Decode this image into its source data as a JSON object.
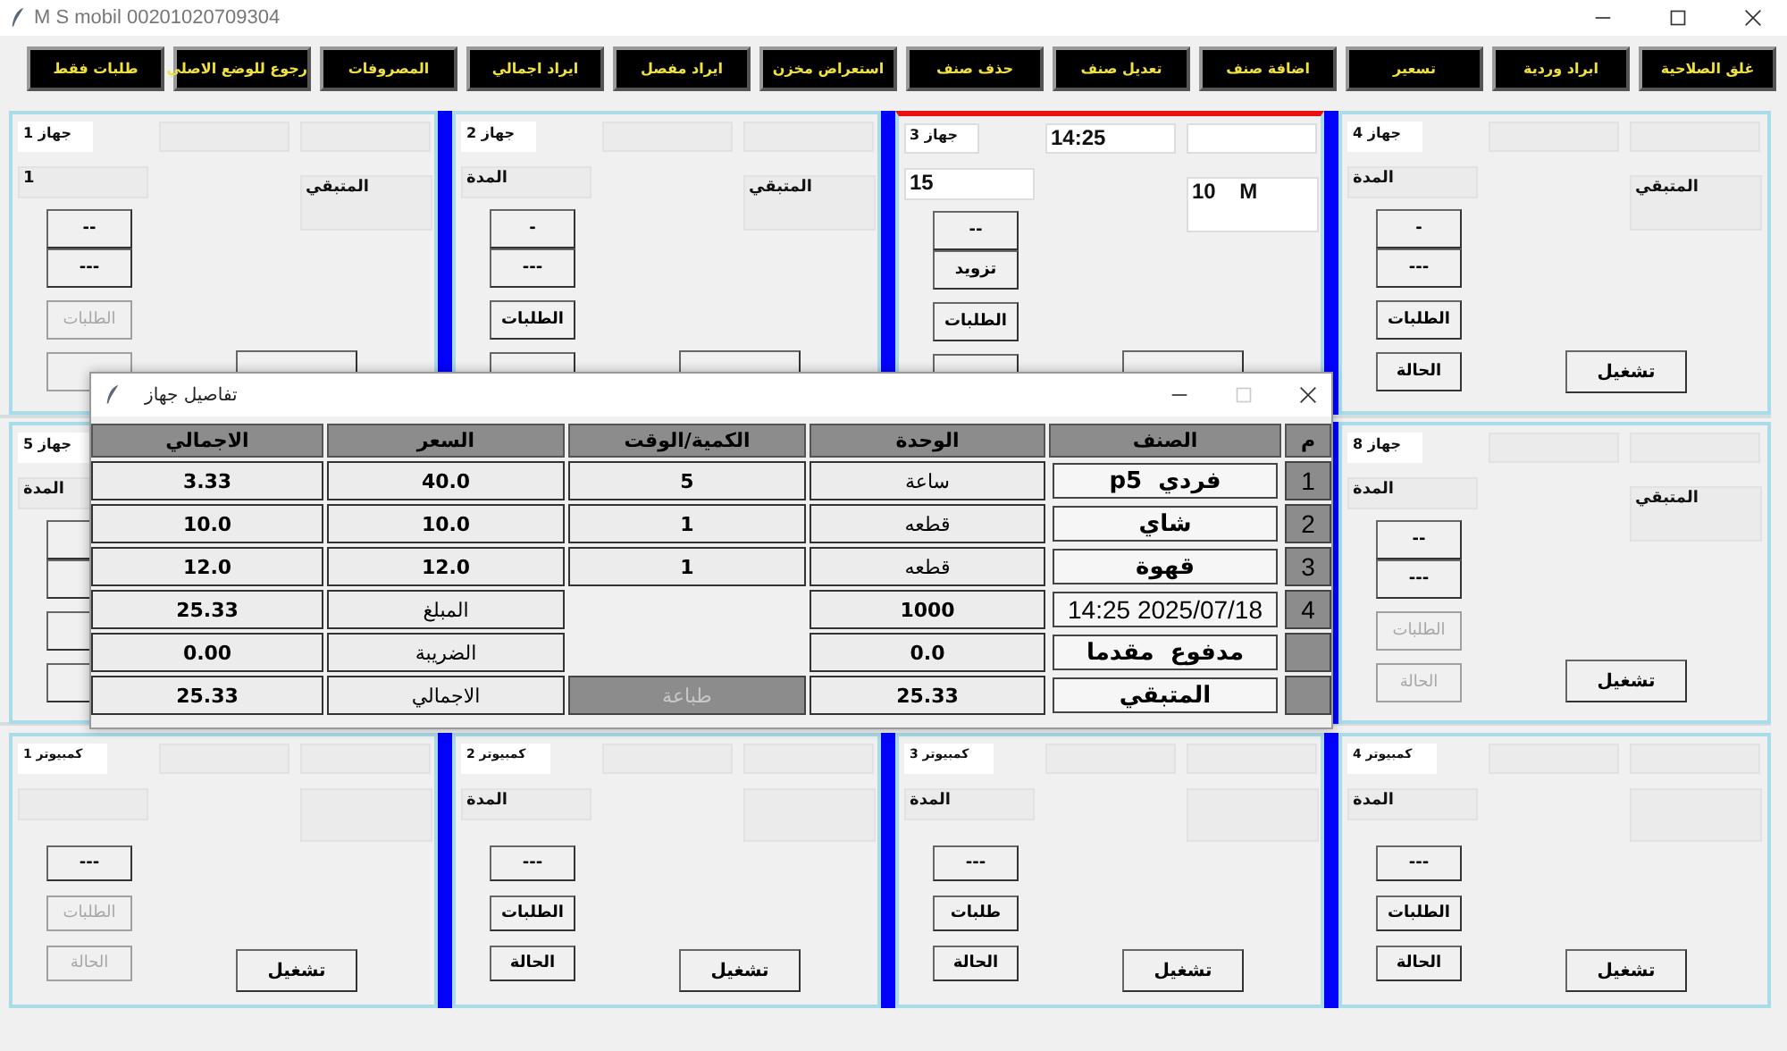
{
  "window": {
    "title": "M S mobil 00201020709304"
  },
  "toolbar": [
    "غلق الصلاحية",
    "ابراد وردية",
    "تسعير",
    "اضافة صنف",
    "تعديل صنف",
    "حذف صنف",
    "استعراض مخزن",
    "ايراد مفصل",
    "ايراد اجمالي",
    "المصروفات",
    "رجوع  للوضع الاصلي",
    "طلبات فقط"
  ],
  "device_rows": [
    [
      {
        "name": "جهاز 4",
        "running": false,
        "duration": "المدة",
        "remaining": "المتبقي",
        "buttons": [
          {
            "label": "-",
            "disabled": false
          },
          {
            "label": "---",
            "disabled": false
          },
          {
            "label": "الطلبات",
            "disabled": false
          },
          {
            "label": "الحالة",
            "disabled": false
          }
        ],
        "start": {
          "label": "تشغيل",
          "disabled": false
        }
      },
      {
        "name": "جهاز 3",
        "running": true,
        "time": "14:25",
        "duration": "15",
        "remaining": "10    M",
        "buttons": [
          {
            "label": "--",
            "disabled": false
          },
          {
            "label": "تزويد",
            "disabled": false
          },
          {
            "label": "الطلبات",
            "disabled": false
          },
          {
            "disabled": false
          }
        ],
        "start": {
          "disabled": false
        }
      },
      {
        "name": "جهاز 2",
        "running": false,
        "duration": "المدة",
        "remaining": "المتبقي",
        "buttons": [
          {
            "label": "-",
            "disabled": false
          },
          {
            "label": "---",
            "disabled": false
          },
          {
            "label": "الطلبات",
            "disabled": false
          },
          {
            "disabled": false
          }
        ],
        "start": {
          "disabled": false
        }
      },
      {
        "name": "جهاز 1",
        "running": false,
        "duration": "1",
        "remaining": "المتبقي",
        "buttons": [
          {
            "label": "--",
            "disabled": false
          },
          {
            "label": "---",
            "disabled": false
          },
          {
            "label": "الطلبات",
            "disabled": true
          },
          {
            "disabled": true
          }
        ],
        "start": {
          "disabled": false
        }
      }
    ],
    [
      {
        "name": "جهاز 8",
        "running": false,
        "duration": "المدة",
        "remaining": "المتبقي",
        "buttons": [
          {
            "label": "--",
            "disabled": false
          },
          {
            "label": "---",
            "disabled": false
          },
          {
            "label": "الطلبات",
            "disabled": true
          },
          {
            "label": "الحالة",
            "disabled": true
          }
        ],
        "start": {
          "label": "تشغيل",
          "disabled": false
        }
      },
      {
        "name": "جهاز 5",
        "running": false,
        "duration": "المدة",
        "buttons": [
          {
            "disabled": false
          },
          {
            "disabled": false
          },
          {
            "disabled": false
          },
          {
            "disabled": false
          }
        ]
      }
    ],
    [
      {
        "name": "كمبيوتر 4",
        "running": false,
        "duration": "المدة",
        "buttons": [
          {
            "label": "---",
            "disabled": false
          },
          {
            "label": "الطلبات",
            "disabled": false
          },
          {
            "label": "الحالة",
            "disabled": false
          }
        ],
        "start": {
          "label": "تشغيل",
          "disabled": false
        }
      },
      {
        "name": "كمبيوتر 3",
        "running": false,
        "duration": "المدة",
        "buttons": [
          {
            "label": "---",
            "disabled": false
          },
          {
            "label": "طلبات",
            "disabled": false
          },
          {
            "label": "الحالة",
            "disabled": false
          }
        ],
        "start": {
          "label": "تشغيل",
          "disabled": false
        }
      },
      {
        "name": "كمبيوتر 2",
        "running": false,
        "duration": "المدة",
        "buttons": [
          {
            "label": "---",
            "disabled": false
          },
          {
            "label": "الطلبات",
            "disabled": false
          },
          {
            "label": "الحالة",
            "disabled": false
          }
        ],
        "start": {
          "label": "تشغيل",
          "disabled": false
        }
      },
      {
        "name": "كمبيوتر 1",
        "running": false,
        "buttons": [
          {
            "label": "---",
            "disabled": false
          },
          {
            "label": "الطلبات",
            "disabled": true
          },
          {
            "label": "الحالة",
            "disabled": true
          }
        ],
        "start": {
          "label": "تشغيل",
          "disabled": false
        }
      }
    ]
  ],
  "dialog": {
    "title": "تفاصيل جهاز",
    "columns": [
      "م",
      "الصنف",
      "الوحدة",
      "الكمية/الوقت",
      "السعر",
      "الاجمالي"
    ],
    "items": [
      {
        "index": "1",
        "name": "فردي  p5",
        "unit": "ساعة",
        "quantity": "5",
        "price": "40.0",
        "total": "3.33"
      },
      {
        "index": "2",
        "name": "شاي",
        "unit": "قطعه",
        "quantity": "1",
        "price": "10.0",
        "total": "10.0"
      },
      {
        "index": "3",
        "name": "قهوة",
        "unit": "قطعه",
        "quantity": "1",
        "price": "12.0",
        "total": "12.0"
      }
    ],
    "summary_rows": [
      {
        "index": "4",
        "item": "2025/07/18 14:25",
        "unit": "1000",
        "label": "المبلغ",
        "value": "25.33"
      },
      {
        "item": "مدفوع  مقدما",
        "unit": "0.0",
        "label": "الضريبة",
        "value": "0.00"
      },
      {
        "item": "المتبقي",
        "unit": "25.33",
        "label": "الاجمالي",
        "value": "25.33"
      }
    ],
    "print_button": {
      "label": "طباعة",
      "disabled": true
    }
  }
}
